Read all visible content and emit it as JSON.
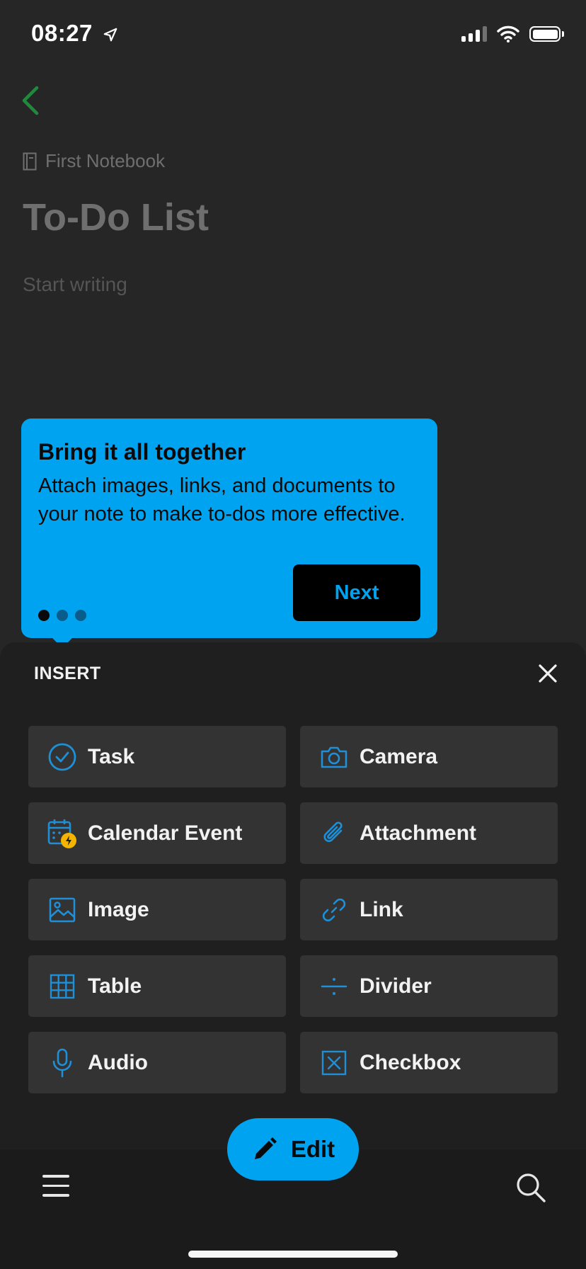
{
  "status_bar": {
    "time": "08:27"
  },
  "note": {
    "notebook_name": "First Notebook",
    "title": "To-Do List",
    "body_placeholder": "Start writing"
  },
  "tooltip": {
    "title": "Bring it all together",
    "text": "Attach images, links, and documents to your note to make to-dos more effective.",
    "next_label": "Next",
    "page_count": 3,
    "current_page": 1
  },
  "insert_sheet": {
    "title": "INSERT",
    "items": [
      {
        "label": "Task",
        "icon": "check-circle-icon"
      },
      {
        "label": "Camera",
        "icon": "camera-icon"
      },
      {
        "label": "Calendar Event",
        "icon": "calendar-event-icon"
      },
      {
        "label": "Attachment",
        "icon": "paperclip-icon"
      },
      {
        "label": "Image",
        "icon": "image-icon"
      },
      {
        "label": "Link",
        "icon": "link-icon"
      },
      {
        "label": "Table",
        "icon": "table-icon"
      },
      {
        "label": "Divider",
        "icon": "divider-icon"
      },
      {
        "label": "Audio",
        "icon": "microphone-icon"
      },
      {
        "label": "Checkbox",
        "icon": "checkbox-icon"
      }
    ]
  },
  "bottom_bar": {
    "edit_label": "Edit"
  },
  "colors": {
    "accent": "#00a3f0",
    "back_green": "#1f8a3c",
    "badge": "#f5b400",
    "icon_blue": "#1f8fd6"
  }
}
